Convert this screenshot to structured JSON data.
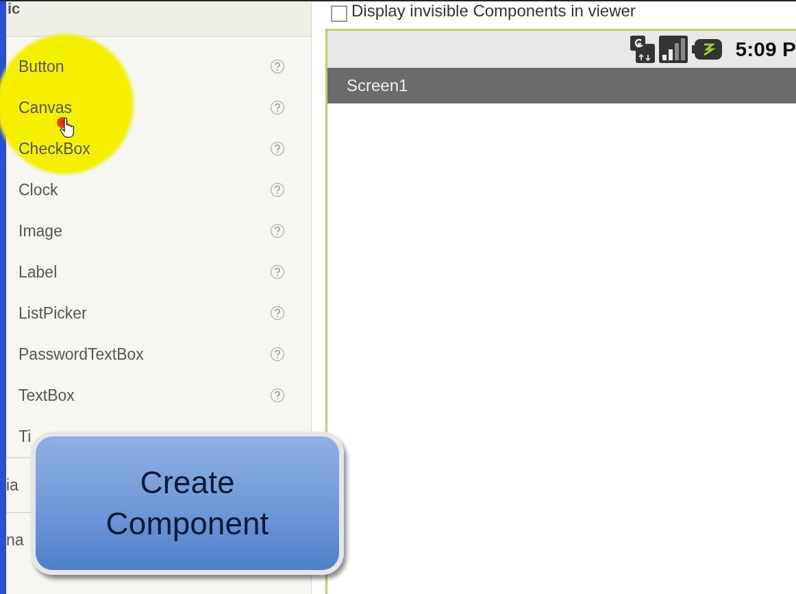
{
  "palette": {
    "header": "ic",
    "items": [
      {
        "label": "Button",
        "help": true
      },
      {
        "label": "Canvas",
        "help": true
      },
      {
        "label": "CheckBox",
        "help": true
      },
      {
        "label": "Clock",
        "help": true
      },
      {
        "label": "Image",
        "help": true
      },
      {
        "label": "Label",
        "help": true
      },
      {
        "label": "ListPicker",
        "help": true
      },
      {
        "label": "PasswordTextBox",
        "help": true
      },
      {
        "label": "TextBox",
        "help": true
      },
      {
        "label": "Ti",
        "help": false
      }
    ],
    "sections": [
      "ia",
      "na"
    ]
  },
  "viewer": {
    "checkbox": {
      "label": "Display invisible Components in viewer",
      "checked": false
    },
    "status_time": "5:09 P",
    "screen_title": "Screen1"
  },
  "callout": {
    "text": "Create Component"
  }
}
